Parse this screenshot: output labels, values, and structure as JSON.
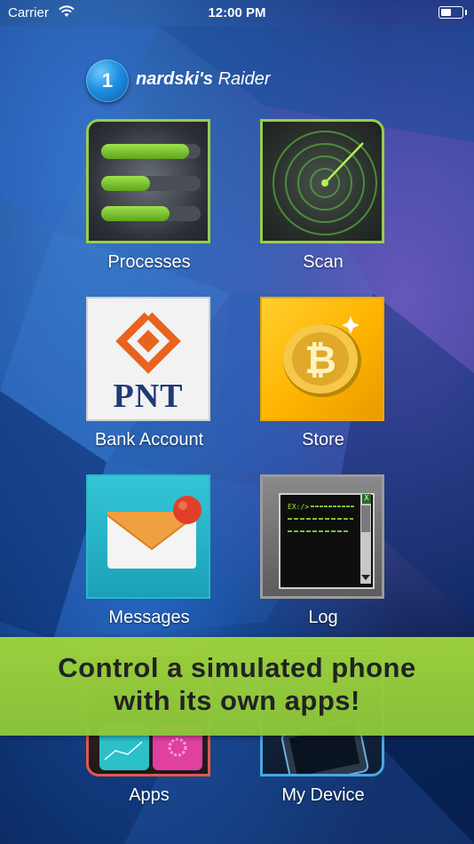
{
  "status_bar": {
    "carrier": "Carrier",
    "time": "12:00 PM"
  },
  "header": {
    "badge_number": "1",
    "title_bold": "nardski's",
    "title_rest": "Raider"
  },
  "apps": [
    {
      "label": "Processes"
    },
    {
      "label": "Scan"
    },
    {
      "label": "Bank Account",
      "logo_text": "PNT"
    },
    {
      "label": "Store"
    },
    {
      "label": "Messages"
    },
    {
      "label": "Log",
      "prompt": "EX:/>",
      "close_glyph": "X"
    },
    {
      "label": "Apps"
    },
    {
      "label": "My Device"
    }
  ],
  "processes_progress": [
    0.88,
    0.49,
    0.69
  ],
  "banner": {
    "line1": "Control a simulated phone",
    "line2": "with its own apps!"
  },
  "colors": {
    "accent_green": "#9acd4a",
    "banner_green": "#8cc63a",
    "store_gold": "#ffb300",
    "messages_teal": "#2db6c8",
    "notification_red": "#e0402a"
  },
  "icons": [
    "wifi-icon",
    "battery-icon",
    "processes-icon",
    "radar-icon",
    "pnt-logo-icon",
    "bitcoin-icon",
    "envelope-icon",
    "terminal-icon",
    "apps-icon",
    "device-icon"
  ]
}
